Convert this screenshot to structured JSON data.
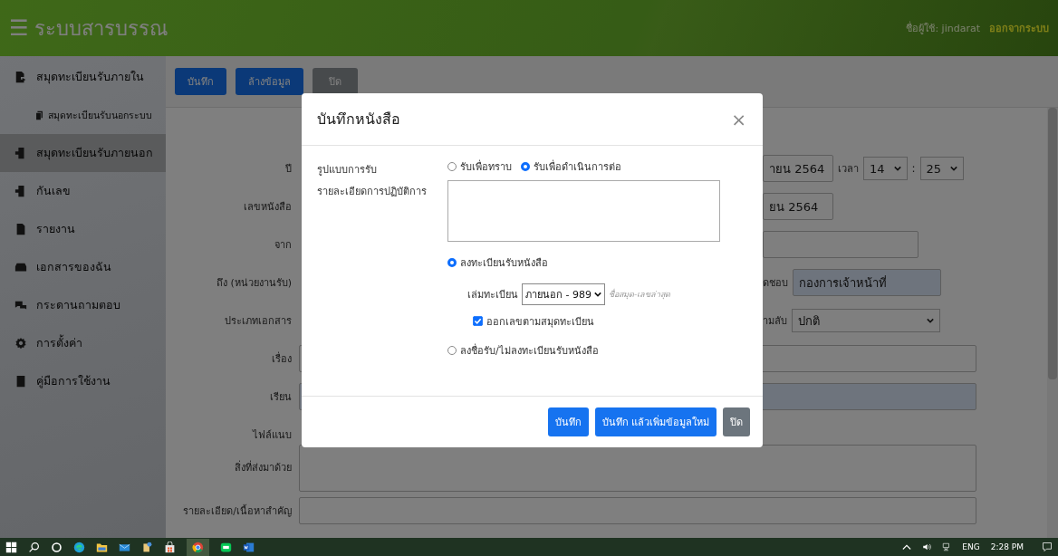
{
  "header": {
    "menu": "☰",
    "title": "ระบบสารบรรณ",
    "user": "ชื่อผู้ใช้: jindarat",
    "logout": "ออกจากระบบ"
  },
  "sidebar": {
    "items": [
      {
        "label": "สมุดทะเบียนรับภายใน",
        "selected": false,
        "children": [
          {
            "label": "สมุดทะเบียนรับนอกระบบ",
            "selected": false
          }
        ]
      },
      {
        "label": "สมุดทะเบียนรับภายนอก",
        "selected": true
      },
      {
        "label": "กันเลข",
        "selected": false
      },
      {
        "label": "รายงาน",
        "selected": false
      },
      {
        "label": "เอกสารของฉัน",
        "selected": false
      },
      {
        "label": "กระดานถามตอบ",
        "selected": false
      },
      {
        "label": "การตั้งค่า",
        "selected": false
      },
      {
        "label": "คู่มือการใช้งาน",
        "selected": false
      }
    ]
  },
  "toolbar": {
    "buttons": [
      {
        "label": "บันทึก",
        "kind": "primary"
      },
      {
        "label": "ล้างข้อมูล",
        "kind": "primary"
      },
      {
        "label": "ปิด",
        "kind": "secondary"
      }
    ]
  },
  "form": {
    "rows": [
      {
        "label": "ปี",
        "kind": "date-time",
        "value": "ายน 2564",
        "time_label": "เวลา",
        "hour": "14",
        "separator": ":",
        "minute": "25"
      },
      {
        "label": "เลขหนังสือ",
        "kind": "partial-input",
        "value": "ยน 2564"
      },
      {
        "label": "จาก",
        "kind": "input",
        "highlighted": false
      },
      {
        "label": "ถึง (หน่วยงานรับ)",
        "kind": "labeled-input",
        "inline_label": "ดชอบ",
        "value": "กองการเจ้าหน้าที่",
        "highlighted": true
      },
      {
        "label": "ประเภทเอกสาร",
        "kind": "labeled-select",
        "inline_label": "ามลับ",
        "value": "ปกติ"
      },
      {
        "label": "เรื่อง",
        "kind": "wide-input",
        "highlighted": false
      },
      {
        "label": "เรียน",
        "kind": "wide-input",
        "highlighted": true
      },
      {
        "label": "ไฟล์แนบ",
        "kind": "hidden"
      },
      {
        "label": "สิ่งที่ส่งมาด้วย",
        "kind": "textarea"
      },
      {
        "label": "รายละเอียด/เนื้อหาสำคัญ",
        "kind": "wide-input",
        "highlighted": false
      }
    ]
  },
  "modal": {
    "title": "บันทึกหนังสือ",
    "close": "×",
    "receive_type": {
      "label": "รูปแบบการรับ",
      "options": [
        {
          "label": "รับเพื่อทราบ",
          "selected": false
        },
        {
          "label": "รับเพื่อดำเนินการต่อ",
          "selected": true
        }
      ]
    },
    "details": {
      "label": "รายละเอียดการปฏิบัติการ"
    },
    "register": {
      "options": [
        {
          "label": "ลงทะเบียนรับหนังสือ",
          "selected": true
        },
        {
          "label": "ลงชื่อรับ/ไม่ลงทะเบียนรับหนังสือ",
          "selected": false
        }
      ],
      "book": {
        "label": "เล่มทะเบียน",
        "value": "ภายนอก - 989",
        "hint": "ชื่อสมุด-เลขล่าสุด"
      },
      "auto_number": {
        "label": "ออกเลขตามสมุดทะเบียน",
        "checked": true
      }
    },
    "buttons": [
      {
        "label": "บันทึก",
        "kind": "primary"
      },
      {
        "label": "บันทึก แล้วเพิ่มข้อมูลใหม่",
        "kind": "primary"
      },
      {
        "label": "ปิด",
        "kind": "secondary"
      }
    ]
  },
  "taskbar": {
    "language": "ENG",
    "time": "2:28 PM"
  }
}
